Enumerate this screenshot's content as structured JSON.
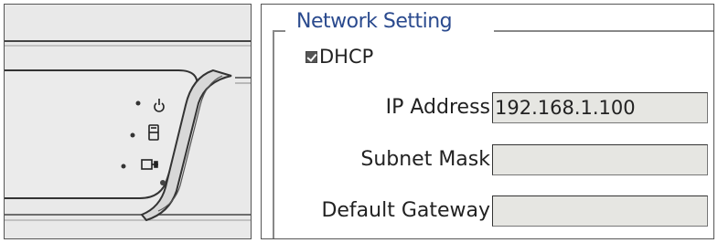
{
  "network_setting": {
    "title": "Network Setting",
    "dhcp": {
      "label": "DHCP",
      "checked": true
    },
    "fields": [
      {
        "label": "IP Address",
        "value": "192.168.1.100"
      },
      {
        "label": "Subnet Mask",
        "value": ""
      },
      {
        "label": "Default Gateway",
        "value": ""
      }
    ]
  },
  "device": {
    "indicator_icons": [
      "power-icon",
      "hdd-icon",
      "network-icon"
    ]
  }
}
